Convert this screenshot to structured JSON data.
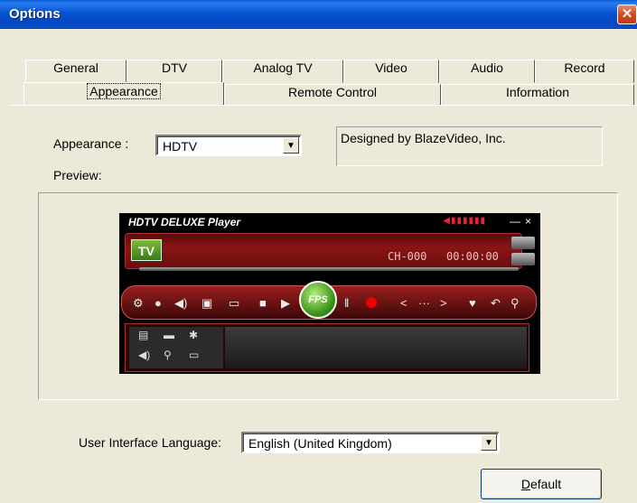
{
  "window": {
    "title": "Options",
    "close": "✕"
  },
  "tabs_row1": [
    "General",
    "DTV",
    "Analog TV",
    "Video",
    "Audio",
    "Record"
  ],
  "tabs_row2": [
    "Appearance",
    "Remote Control",
    "Information"
  ],
  "appearance": {
    "label": "Appearance :",
    "value": "HDTV",
    "preview_label": "Preview:",
    "designer": "Designed by BlazeVideo, Inc."
  },
  "player": {
    "title": "HDTV DELUXE Player",
    "tv": "TV",
    "channel": "CH-000",
    "time": "00:00:00",
    "play": "FPS"
  },
  "language": {
    "label": "User Interface Language:",
    "value": "English (United Kingdom)"
  },
  "buttons": {
    "default_first": "D",
    "default_rest": "efault"
  }
}
